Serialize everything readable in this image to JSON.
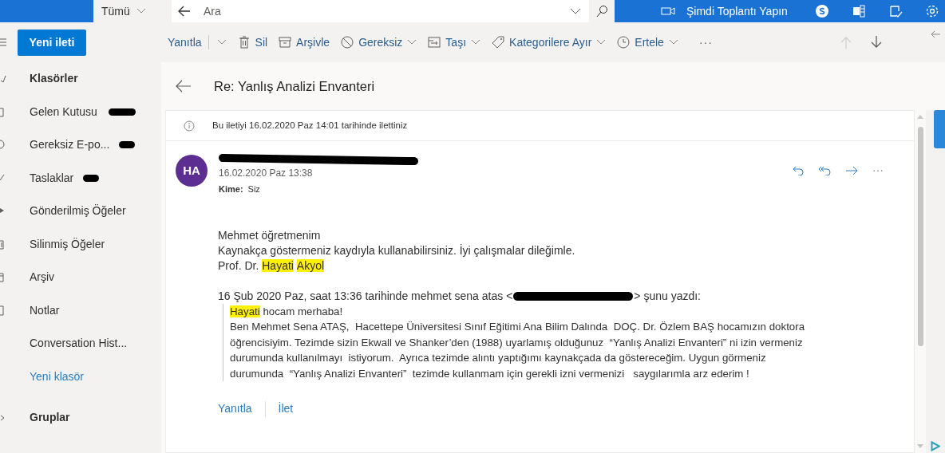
{
  "top_bar": {
    "scope": "Tümü",
    "search": {
      "placeholder": "Ara"
    },
    "meet_now": "Şimdi Toplantı Yapın",
    "apps": [
      {
        "kind": "skype"
      },
      {
        "kind": "office"
      },
      {
        "kind": "feedback"
      },
      {
        "kind": "settings"
      }
    ]
  },
  "toolbar": {
    "new_message": "Yeni ileti",
    "actions": [
      {
        "label": "Yanıtla",
        "kind": "split"
      },
      {
        "label": "Sil",
        "kind": "delete",
        "dropdown": false
      },
      {
        "label": "Arşivle",
        "kind": "archive",
        "dropdown": false
      },
      {
        "label": "Gereksiz",
        "kind": "junk",
        "dropdown": true
      },
      {
        "label": "Taşı",
        "kind": "move",
        "dropdown": true
      },
      {
        "label": "Kategorilere Ayır",
        "kind": "tag",
        "dropdown": true
      },
      {
        "label": "Ertele",
        "kind": "snooze",
        "dropdown": true
      }
    ],
    "more": "···",
    "nav": [
      {
        "kind": "up",
        "disabled": true
      },
      {
        "kind": "down",
        "disabled": false
      }
    ]
  },
  "sidebar": {
    "header": "Klasörler",
    "folders": [
      {
        "label": "Gelen Kutusu",
        "count_redacted": true
      },
      {
        "label": "Gereksiz E-po...",
        "count_redacted": true
      },
      {
        "label": "Taslaklar",
        "count_redacted": true
      },
      {
        "label": "Gönderilmiş Öğeler",
        "count_redacted": false
      },
      {
        "label": "Silinmiş Öğeler",
        "count_redacted": false
      },
      {
        "label": "Arşiv",
        "count_redacted": false
      },
      {
        "label": "Notlar",
        "count_redacted": false
      },
      {
        "label": "Conversation Hist...",
        "count_redacted": false
      }
    ],
    "new_folder": "Yeni klasör",
    "groups": "Gruplar"
  },
  "message": {
    "subject": "Re: Yanlış Analizi Envanteri",
    "notice": "Bu iletiyi 16.02.2020 Paz 14:01 tarihinde ilettiniz",
    "avatar": "HA",
    "date": "16.02.2020 Paz 13:38",
    "to_label": "Kime:",
    "to": "Siz",
    "more": "···",
    "body": [
      [
        {
          "text": "Mehmet öğretmenim",
          "highlight": false
        }
      ],
      [
        {
          "text": "Kaynakça göstermeniz kaydıyla kullanabilirsiniz. İyi çalışmalar dileğimle.",
          "highlight": false
        }
      ],
      [
        {
          "text": "Prof. Dr. ",
          "highlight": false
        },
        {
          "text": "Hayati",
          "highlight": true
        },
        {
          "text": "Akyol",
          "highlight": true
        }
      ]
    ],
    "quote_header": {
      "before": "16 Şub 2020 Paz, saat 13:36 tarihinde mehmet sena atas <",
      "after": "> şunu yazdı:"
    },
    "quote": [
      [
        {
          "text": "Hayati",
          "highlight": true
        },
        {
          "text": " hocam merhaba!",
          "highlight": false
        }
      ],
      [
        {
          "text": "Ben Mehmet Sena ATAŞ,  Hacettepe Üniversitesi Sınıf Eğitimi Ana Bilim Dalında  DOÇ. Dr. Özlem BAŞ hocamızın doktora",
          "highlight": false
        }
      ],
      [
        {
          "text": "öğrencisiyim. Tezimde sizin Ekwall ve Shanker’den (1988) uyarlamış olduğunuz  “Yanlış Analizi Envanteri” ni izin vermeniz",
          "highlight": false
        }
      ],
      [
        {
          "text": "durumunda kullanılmayı  istiyorum.  Ayrıca tezimde alıntı yaptığımı kaynakçada da göstereceğim. Uygun görmeniz",
          "highlight": false
        }
      ],
      [
        {
          "text": "durumunda  “Yanlış Analizi Envanteri”  tezimde kullanmam için gerekli izni vermenizi   saygılarımla arz ederim !",
          "highlight": false
        }
      ]
    ],
    "reply": "Yanıtla",
    "forward": "İlet"
  }
}
